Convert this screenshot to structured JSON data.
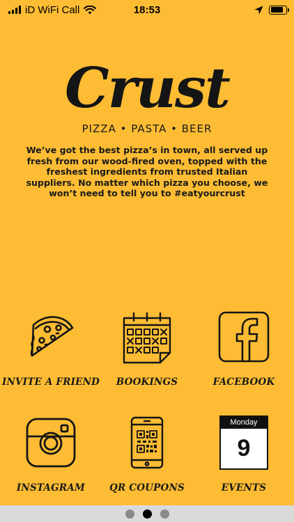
{
  "status_bar": {
    "carrier": "iD WiFi Call",
    "time": "18:53",
    "battery_level": 0.85
  },
  "brand": {
    "logo": "Crust",
    "tagline": "PIZZA • PASTA • BEER",
    "intro": "We’ve got the best pizza’s in town, all served up fresh from our wood-fired oven, topped with the freshest ingredients from trusted Italian suppliers. No matter which pizza you choose, we won’t need to tell you to #eatyourcrust"
  },
  "tiles": [
    {
      "label": "INVITE A FRIEND",
      "icon": "pizza-slice-icon"
    },
    {
      "label": "BOOKINGS",
      "icon": "calendar-icon"
    },
    {
      "label": "FACEBOOK",
      "icon": "facebook-icon"
    },
    {
      "label": "INSTAGRAM",
      "icon": "instagram-icon"
    },
    {
      "label": "QR COUPONS",
      "icon": "qr-phone-icon"
    },
    {
      "label": "EVENTS",
      "icon": "event-calendar-icon"
    }
  ],
  "events_calendar": {
    "weekday": "Monday",
    "day": "9"
  },
  "pager": {
    "pages": 3,
    "active": 2
  },
  "colors": {
    "background": "#FDBC33",
    "ink": "#151515",
    "pager_bar": "#DADADA"
  }
}
